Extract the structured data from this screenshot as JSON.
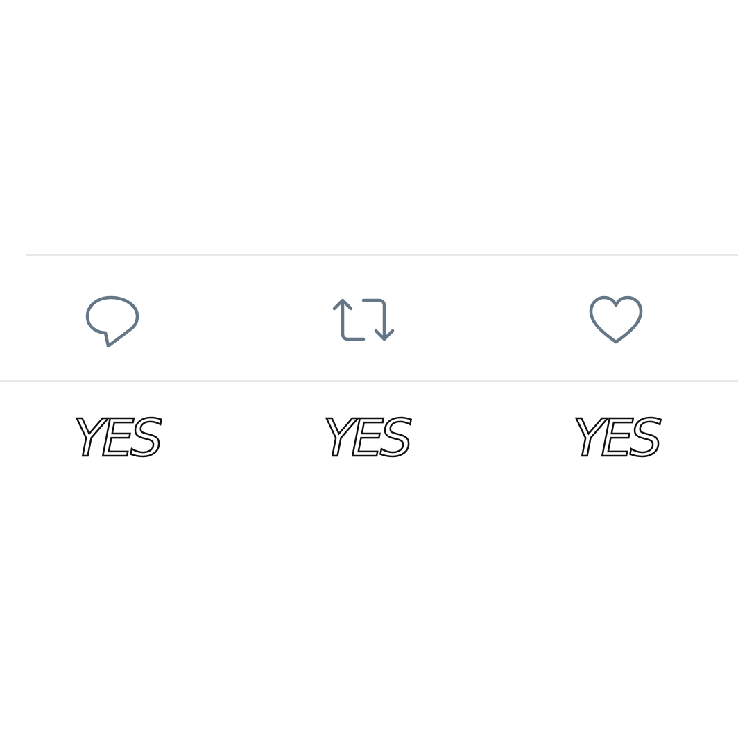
{
  "tweet_actions": {
    "icon_color": "#657786",
    "items": [
      {
        "icon": "reply-icon",
        "caption": "YES"
      },
      {
        "icon": "retweet-icon",
        "caption": "YES"
      },
      {
        "icon": "like-icon",
        "caption": "YES"
      }
    ]
  }
}
